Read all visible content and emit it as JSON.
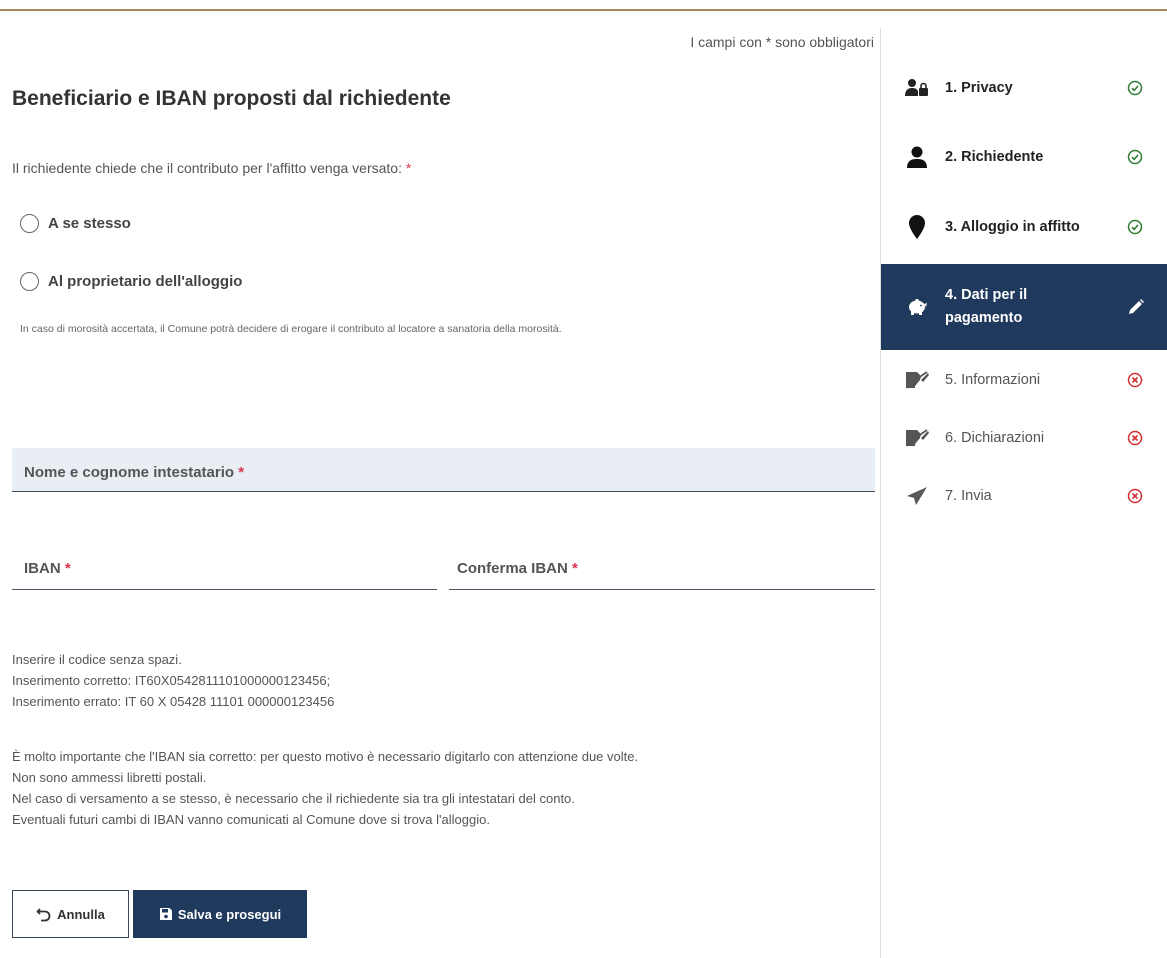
{
  "required_note": "I campi con * sono obbligatori",
  "section_title": "Beneficiario e IBAN proposti dal richiedente",
  "question": {
    "text": "Il richiedente chiede che il contributo per l'affitto venga versato:",
    "star": "*"
  },
  "radios": [
    {
      "label": "A se stesso",
      "selected": false
    },
    {
      "label": "Al proprietario dell'alloggio",
      "selected": false
    }
  ],
  "hint": "In caso di morosità accertata, il Comune potrà decidere di erogare il contributo al locatore a sanatoria della morosità.",
  "fields": {
    "holder_name": {
      "label": "Nome e cognome intestatario",
      "star": "*",
      "value": ""
    },
    "iban": {
      "label": "IBAN",
      "star": "*",
      "value": ""
    },
    "iban_confirm": {
      "label": "Conferma IBAN",
      "star": "*",
      "value": ""
    }
  },
  "iban_help": [
    "Inserire il codice senza spazi.",
    "Inserimento corretto: IT60X0542811101000000123456;",
    "Inserimento errato: IT 60 X 05428 11101 000000123456"
  ],
  "important_notes": [
    "È molto importante che l'IBAN sia corretto: per questo motivo è necessario digitarlo con attenzione due volte.",
    "Non sono ammessi libretti postali.",
    "Nel caso di versamento a se stesso, è necessario che il richiedente sia tra gli intestatari del conto.",
    "Eventuali futuri cambi di IBAN vanno comunicati al Comune dove si trova l'alloggio."
  ],
  "buttons": {
    "cancel": "Annulla",
    "save": "Salva e prosegui"
  },
  "steps": [
    {
      "label": "1. Privacy",
      "icon": "users-lock-icon",
      "status": "completed"
    },
    {
      "label": "2. Richiedente",
      "icon": "user-icon",
      "status": "completed"
    },
    {
      "label": "3. Alloggio in affitto",
      "icon": "map-pin-icon",
      "status": "completed"
    },
    {
      "label": "4. Dati per il pagamento",
      "icon": "piggy-bank-icon",
      "status": "editing"
    },
    {
      "label": "5. Informazioni",
      "icon": "file-signature-icon",
      "status": "incomplete"
    },
    {
      "label": "6. Dichiarazioni",
      "icon": "file-signature-icon",
      "status": "incomplete"
    },
    {
      "label": "7. Invia",
      "icon": "paper-plane-icon",
      "status": "incomplete"
    }
  ],
  "colors": {
    "primary": "#1f3a5c",
    "required_star": "#d9364f",
    "completed": "#2e7d32",
    "incomplete": "#d32f2f",
    "top_border": "#a48a5c",
    "field_background": "#e9edf4"
  }
}
